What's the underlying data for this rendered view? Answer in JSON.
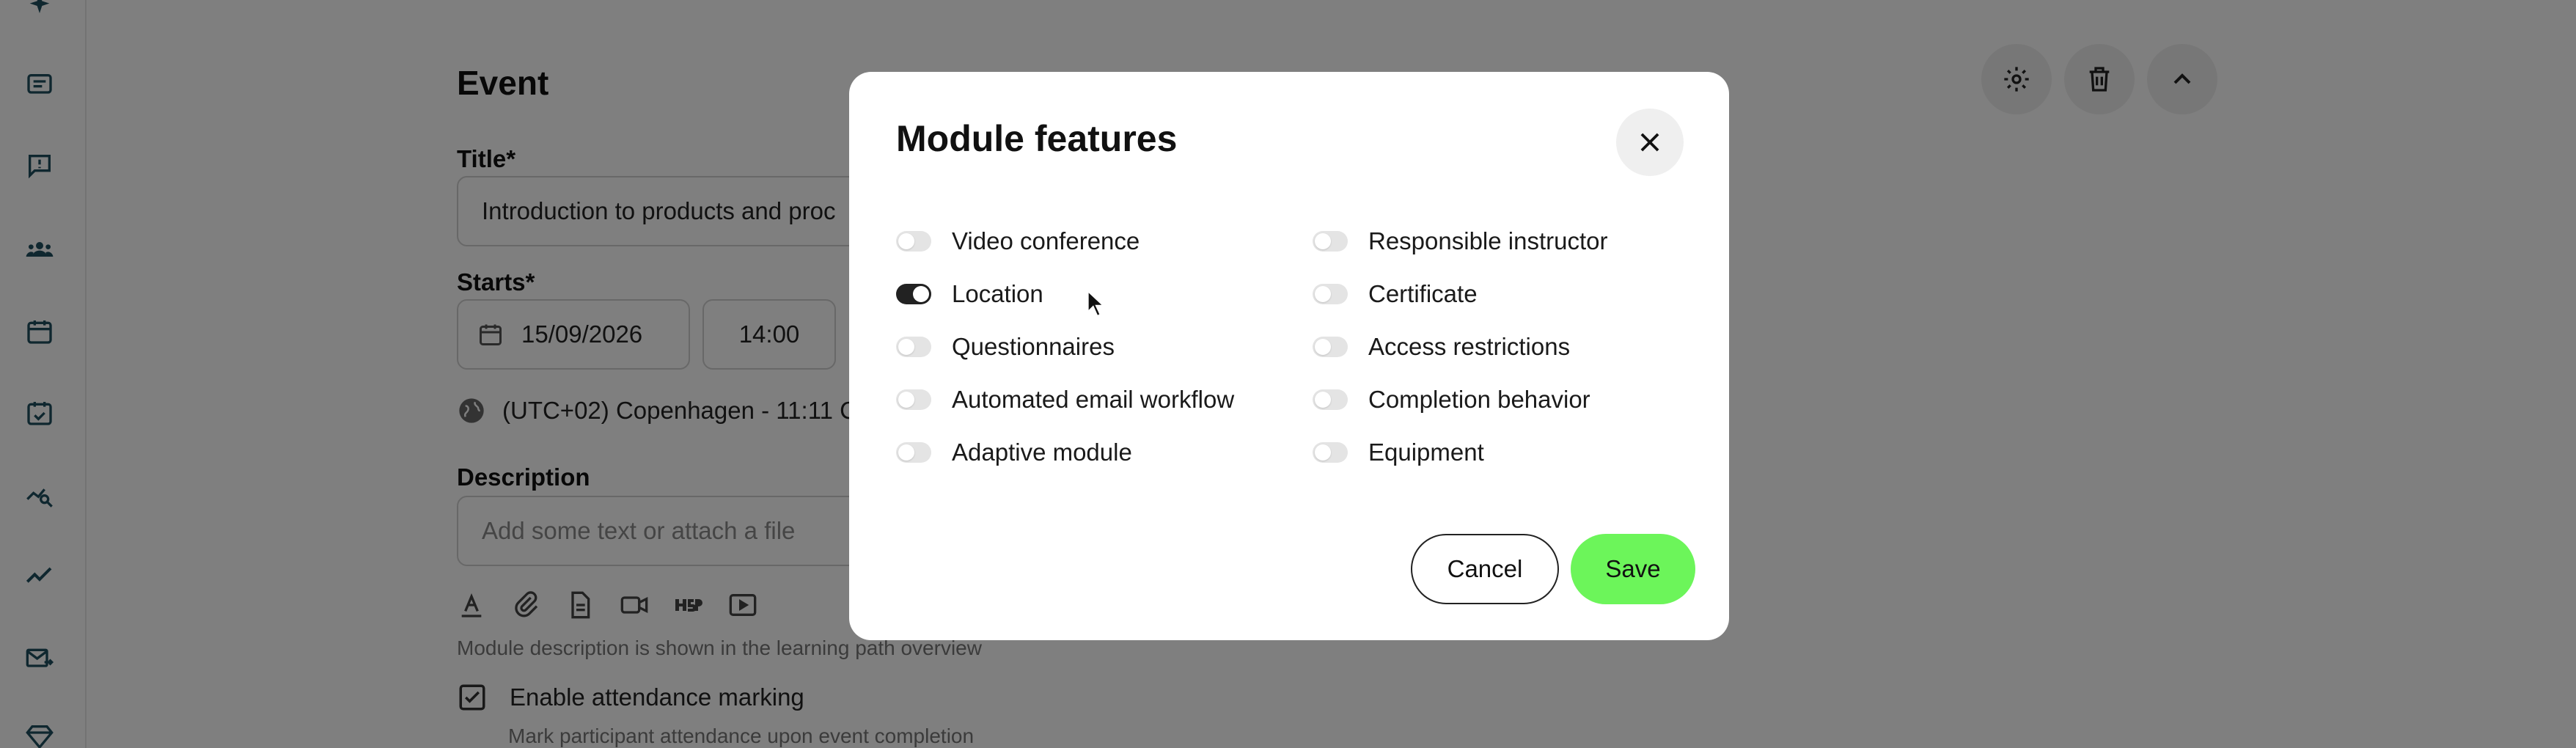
{
  "page": {
    "title": "Event",
    "title_label": "Title*",
    "title_value": "Introduction to products and proc",
    "starts_label": "Starts*",
    "start_date": "15/09/2026",
    "start_time": "14:00",
    "timezone": "(UTC+02) Copenhagen - 11:11 C",
    "description_label": "Description",
    "description_placeholder": "Add some text or attach a file",
    "description_hint": "Module description is shown in the learning path overview",
    "attendance_label": "Enable attendance marking",
    "attendance_hint": "Mark participant attendance upon event completion"
  },
  "sidebar": {
    "icons": [
      "sparkle-icon",
      "list-icon",
      "feedback-icon",
      "users-icon",
      "calendar-icon",
      "calendar-check-icon",
      "search-analytics-icon",
      "trend-icon",
      "mail-send-icon",
      "diamond-icon"
    ]
  },
  "modal": {
    "title": "Module features",
    "features_left": [
      {
        "label": "Video conference",
        "on": false
      },
      {
        "label": "Location",
        "on": true
      },
      {
        "label": "Questionnaires",
        "on": false
      },
      {
        "label": "Automated email workflow",
        "on": false
      },
      {
        "label": "Adaptive module",
        "on": false
      }
    ],
    "features_right": [
      {
        "label": "Responsible instructor",
        "on": false
      },
      {
        "label": "Certificate",
        "on": false
      },
      {
        "label": "Access restrictions",
        "on": false
      },
      {
        "label": "Completion behavior",
        "on": false
      },
      {
        "label": "Equipment",
        "on": false
      }
    ],
    "cancel_label": "Cancel",
    "save_label": "Save"
  },
  "colors": {
    "save_button": "#6cf55a",
    "toggle_on": "#222222",
    "toggle_off": "#e4e4e4"
  }
}
